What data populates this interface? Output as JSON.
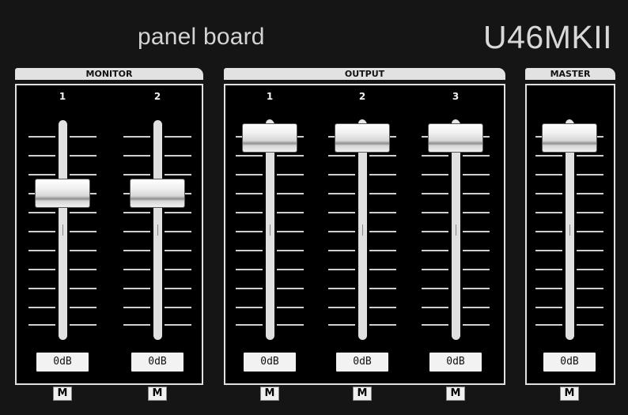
{
  "header": {
    "title": "panel board",
    "brand": "U46MKII"
  },
  "sections": {
    "monitor": "MONITOR",
    "output": "OUTPUT",
    "master": "MASTER"
  },
  "channels": [
    {
      "group": "monitor",
      "label": "1",
      "level_fraction": 0.7,
      "db": "0dB",
      "mute": "M"
    },
    {
      "group": "monitor",
      "label": "2",
      "level_fraction": 0.7,
      "db": "0dB",
      "mute": "M"
    },
    {
      "group": "output",
      "label": "1",
      "level_fraction": 1.0,
      "db": "0dB",
      "mute": "M"
    },
    {
      "group": "output",
      "label": "2",
      "level_fraction": 1.0,
      "db": "0dB",
      "mute": "M"
    },
    {
      "group": "output",
      "label": "3",
      "level_fraction": 1.0,
      "db": "0dB",
      "mute": "M"
    },
    {
      "group": "master",
      "label": "",
      "level_fraction": 1.0,
      "db": "0dB",
      "mute": "M"
    }
  ],
  "colors": {
    "background": "#151515",
    "panel": "#000000",
    "accent": "#e2e2e2"
  }
}
